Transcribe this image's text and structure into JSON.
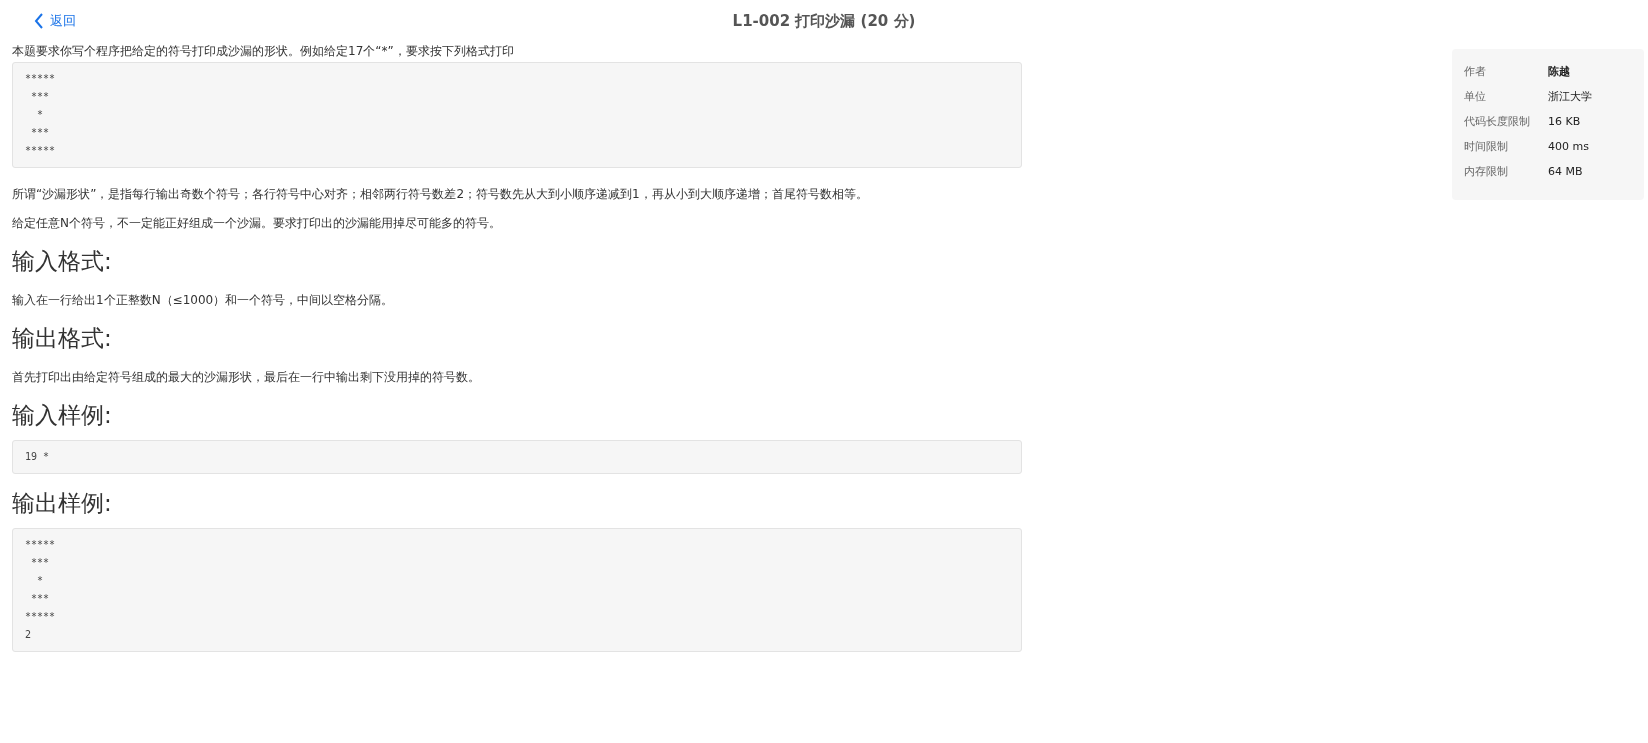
{
  "header": {
    "back_label": "返回",
    "title": "L1-002 打印沙漏 (20 分)"
  },
  "content": [
    {
      "kind": "paragraph",
      "text": "本题要求你写个程序把给定的符号打印成沙漏的形状。例如给定17个“*”，要求按下列格式打印"
    },
    {
      "kind": "code",
      "text": "*****\n ***\n  *\n ***\n*****"
    },
    {
      "kind": "paragraph",
      "text": "所谓“沙漏形状”，是指每行输出奇数个符号；各行符号中心对齐；相邻两行符号数差2；符号数先从大到小顺序递减到1，再从小到大顺序递增；首尾符号数相等。"
    },
    {
      "kind": "paragraph",
      "text": "给定任意N个符号，不一定能正好组成一个沙漏。要求打印出的沙漏能用掉尽可能多的符号。"
    },
    {
      "kind": "heading",
      "text": "输入格式:"
    },
    {
      "kind": "paragraph",
      "text": "输入在一行给出1个正整数N（≤1000）和一个符号，中间以空格分隔。"
    },
    {
      "kind": "heading",
      "text": "输出格式:"
    },
    {
      "kind": "paragraph",
      "text": "首先打印出由给定符号组成的最大的沙漏形状，最后在一行中输出剩下没用掉的符号数。"
    },
    {
      "kind": "heading",
      "text": "输入样例:"
    },
    {
      "kind": "code",
      "text": "19 *"
    },
    {
      "kind": "heading",
      "text": "输出样例:"
    },
    {
      "kind": "code",
      "text": "*****\n ***\n  *\n ***\n*****\n2"
    }
  ],
  "info": [
    {
      "label": "作者",
      "value": "陈越"
    },
    {
      "label": "单位",
      "value": "浙江大学"
    },
    {
      "label": "代码长度限制",
      "value": "16 KB"
    },
    {
      "label": "时间限制",
      "value": "400 ms"
    },
    {
      "label": "内存限制",
      "value": "64 MB"
    }
  ]
}
